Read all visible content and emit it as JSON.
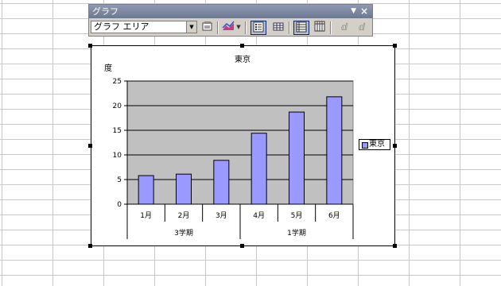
{
  "toolbar": {
    "title": "グラフ",
    "object_select": "グラフ エリア",
    "buttons": [
      "format-chart-area",
      "chart-type",
      "legend",
      "data-table",
      "by-row",
      "by-column",
      "angle-text-downward",
      "angle-text-upward"
    ]
  },
  "chart_data": {
    "type": "bar",
    "title": "東京",
    "ylabel": "度",
    "xlabel": "",
    "categories": [
      "1月",
      "2月",
      "3月",
      "4月",
      "5月",
      "6月"
    ],
    "groups": [
      {
        "label": "3学期",
        "categories": [
          "1月",
          "2月",
          "3月"
        ]
      },
      {
        "label": "1学期",
        "categories": [
          "4月",
          "5月",
          "6月"
        ]
      }
    ],
    "series": [
      {
        "name": "東京",
        "values": [
          5.8,
          6.1,
          8.9,
          14.4,
          18.7,
          21.8
        ]
      }
    ],
    "ylim": [
      0,
      25
    ],
    "yticks": [
      0,
      5,
      10,
      15,
      20,
      25
    ],
    "grid": true,
    "legend": "right",
    "colors": {
      "bar": "#9999ff",
      "plot_bg": "#c0c0c0"
    }
  }
}
